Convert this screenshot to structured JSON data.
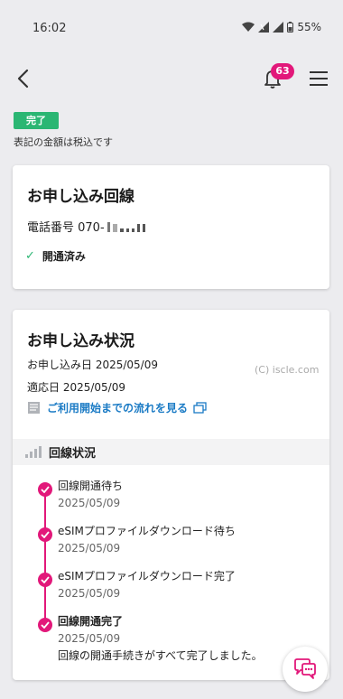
{
  "status_bar": {
    "time": "16:02",
    "battery": "55%"
  },
  "header": {
    "notification_count": "63"
  },
  "status_tag": "完了",
  "tax_note": "表記の金額は税込です",
  "line_card": {
    "title": "お申し込み回線",
    "phone_label": "電話番号 070-",
    "activation_status": "開通済み"
  },
  "application_card": {
    "title": "お申し込み状況",
    "application_date": "お申し込み日 2025/05/09",
    "effective_date": "適応日 2025/05/09",
    "watermark": "(C) iscle.com",
    "flow_link": "ご利用開始までの流れを見る",
    "section_title": "回線状況",
    "timeline": [
      {
        "label": "回線開通待ち",
        "date": "2025/05/09"
      },
      {
        "label": "eSIMプロファイルダウンロード待ち",
        "date": "2025/05/09"
      },
      {
        "label": "eSIMプロファイルダウンロード完了",
        "date": "2025/05/09"
      },
      {
        "label": "回線開通完了",
        "date": "2025/05/09",
        "message": "回線の開通手続きがすべて完了しました。"
      }
    ]
  },
  "colors": {
    "accent": "#e2187a",
    "success": "#2bb673",
    "link": "#1b7bc5"
  },
  "icons": {
    "back": "back-arrow-icon",
    "notification": "bell-icon",
    "menu": "hamburger-menu-icon",
    "chat": "chat-support-icon"
  }
}
